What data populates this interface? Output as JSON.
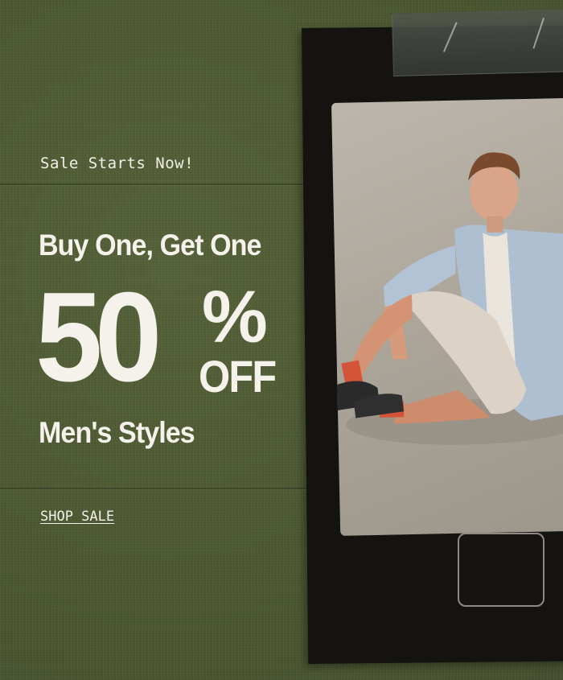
{
  "promo": {
    "eyebrow": "Sale Starts Now!",
    "headline": "Buy One, Get One",
    "discount_number": "50",
    "discount_symbol": "%",
    "discount_off": "OFF",
    "subhead": "Men's Styles",
    "cta_label": "SHOP SALE"
  },
  "image": {
    "subject": "man-sitting-photo"
  },
  "colors": {
    "background": "#4f5a34",
    "text": "#f4f2ea",
    "phone_frame": "#141310",
    "sock_accent": "#d4543a"
  }
}
